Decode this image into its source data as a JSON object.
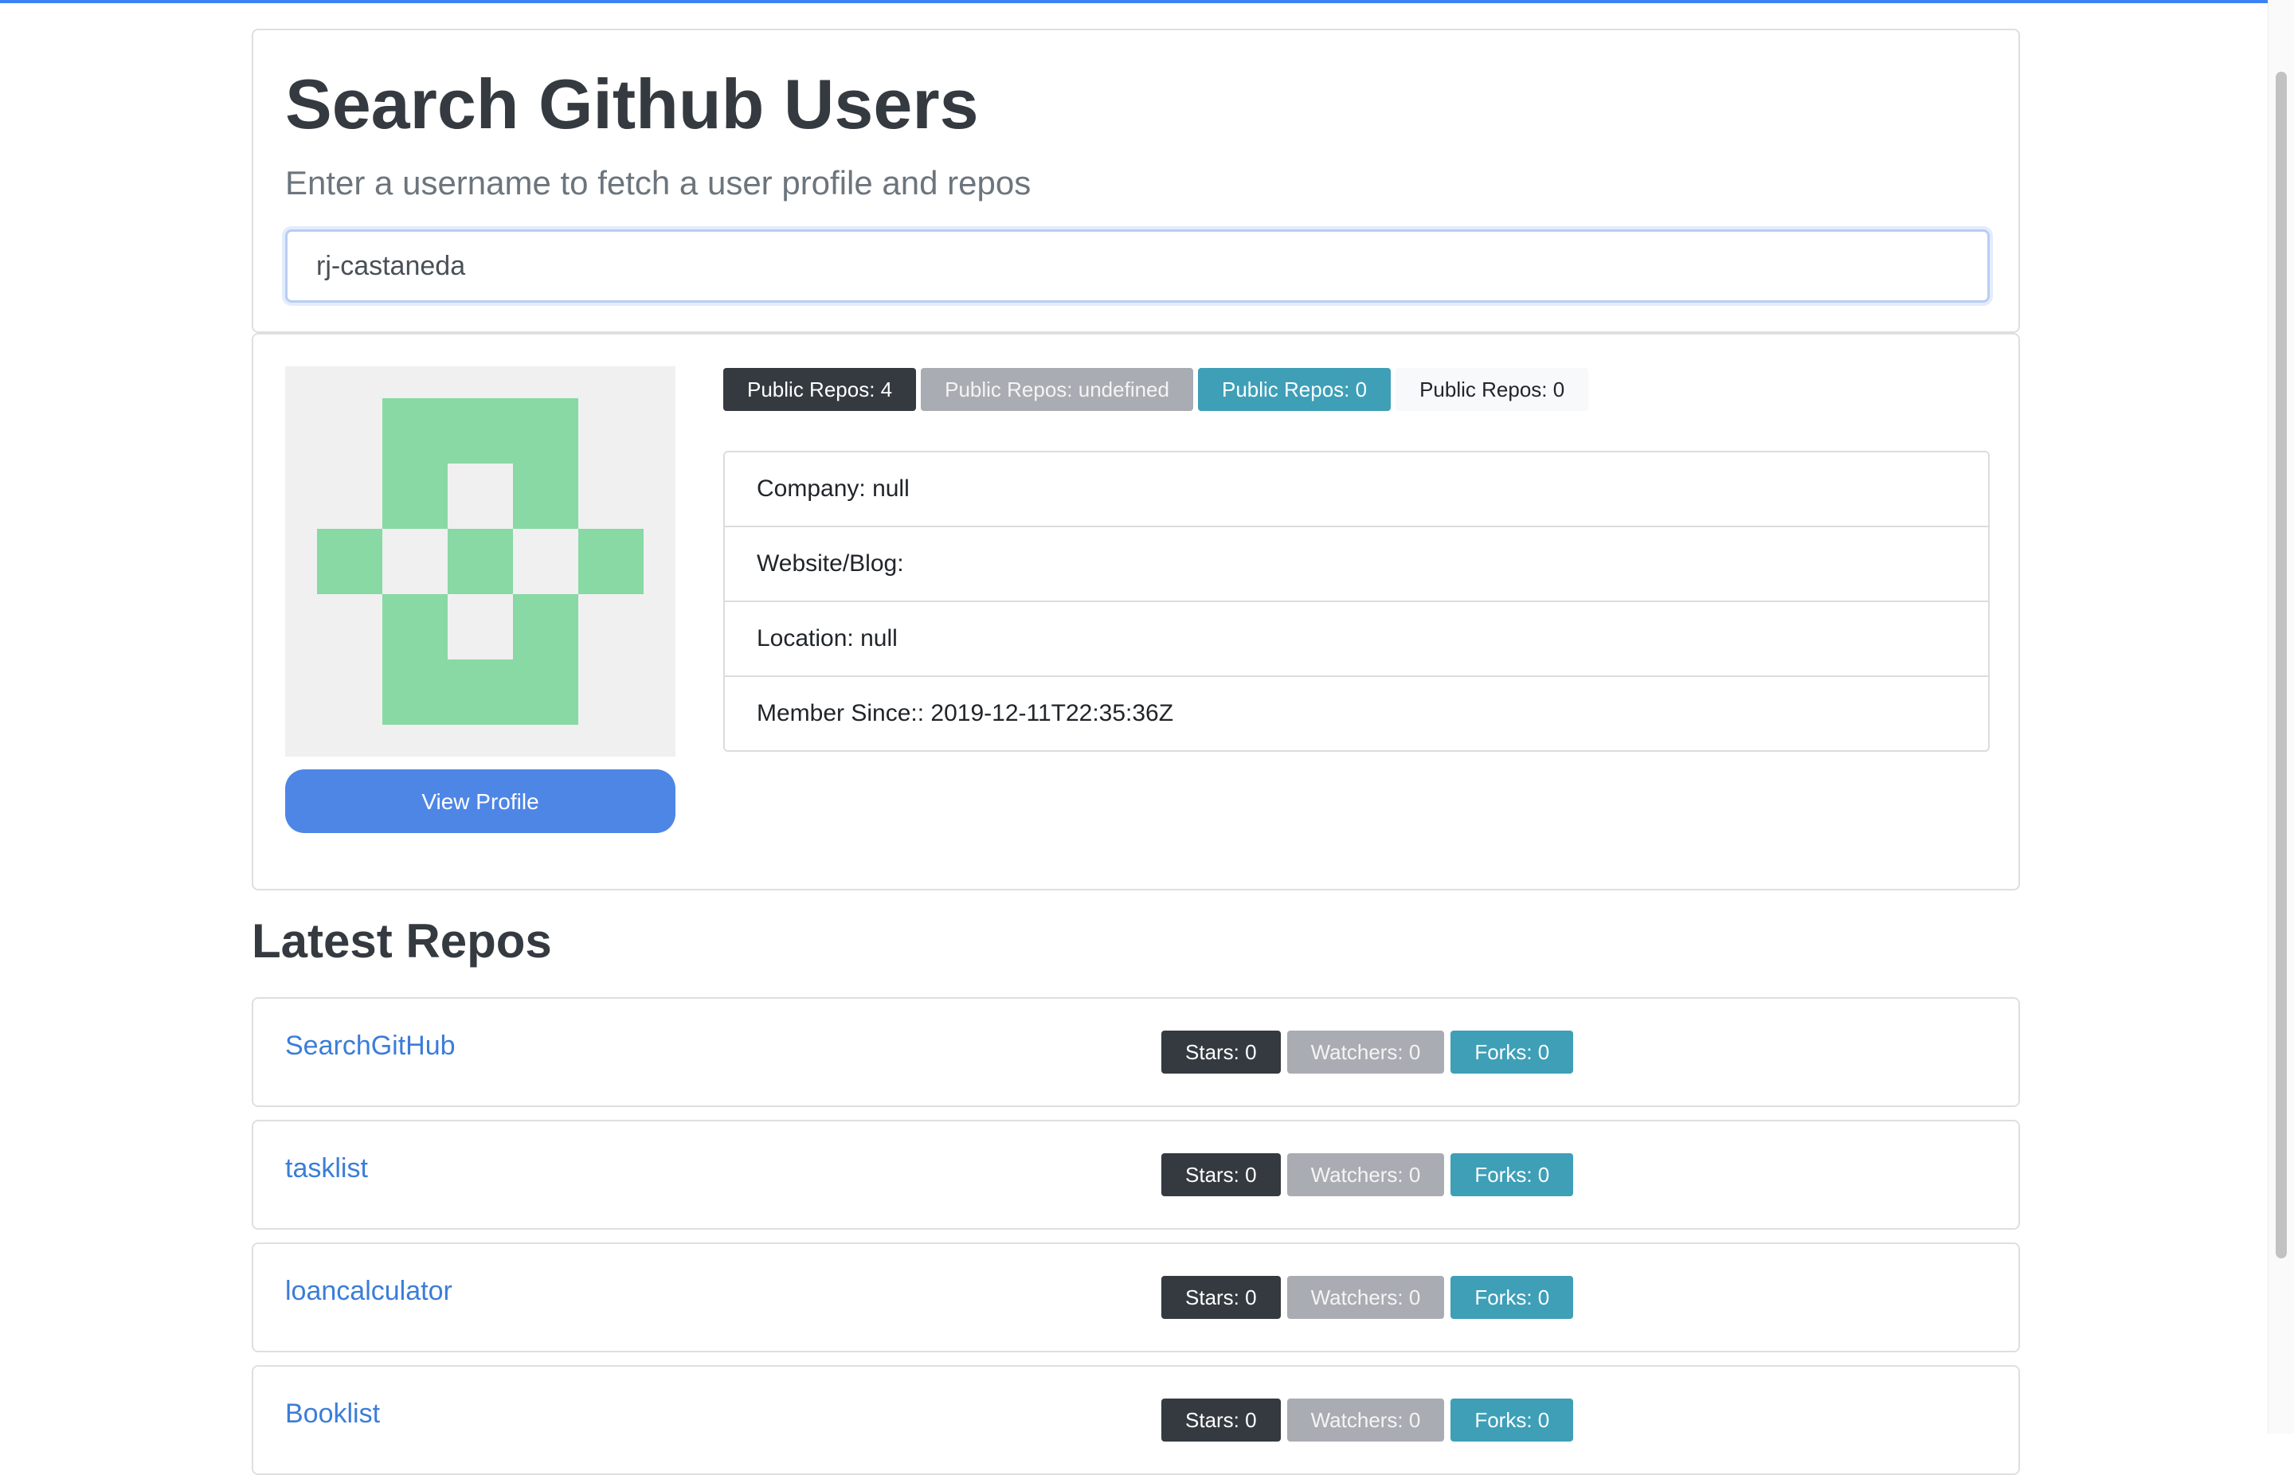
{
  "header": {
    "title": "Search Github Users",
    "subtitle": "Enter a username to fetch a user profile and repos"
  },
  "search": {
    "value": "rj-castaneda"
  },
  "profile": {
    "view_profile_label": "View Profile",
    "badges": [
      {
        "label": "Public Repos: 4",
        "style": "dark"
      },
      {
        "label": "Public Repos: undefined",
        "style": "gray"
      },
      {
        "label": "Public Repos: 0",
        "style": "teal"
      },
      {
        "label": "Public Repos: 0",
        "style": "light"
      }
    ],
    "details": [
      "Company: null",
      "Website/Blog:",
      "Location: null",
      "Member Since:: 2019-12-11T22:35:36Z"
    ],
    "avatar_colors": {
      "fill": "#88d9a4",
      "background": "#f0f0f0"
    }
  },
  "repos_section": {
    "title": "Latest Repos",
    "repos": [
      {
        "name": "SearchGitHub",
        "stars": "Stars: 0",
        "watchers": "Watchers: 0",
        "forks": "Forks: 0"
      },
      {
        "name": "tasklist",
        "stars": "Stars: 0",
        "watchers": "Watchers: 0",
        "forks": "Forks: 0"
      },
      {
        "name": "loancalculator",
        "stars": "Stars: 0",
        "watchers": "Watchers: 0",
        "forks": "Forks: 0"
      },
      {
        "name": "Booklist",
        "stars": "Stars: 0",
        "watchers": "Watchers: 0",
        "forks": "Forks: 0"
      }
    ]
  },
  "colors": {
    "accent": "#4e86e6",
    "badge_dark": "#343a40",
    "badge_gray": "#a9acb2",
    "badge_teal": "#3e9fb7",
    "badge_light": "#f8f9fa",
    "link": "#3b7dd8"
  }
}
